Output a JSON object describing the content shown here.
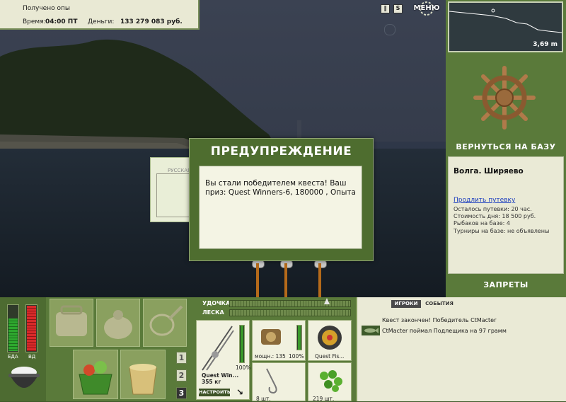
{
  "status": {
    "message": "Получено опы",
    "time_label": "Время:",
    "time_value": "04:00 ПТ",
    "money_label": "Деньги:",
    "money_value": "133 279 083 руб."
  },
  "topbar": {
    "menu_label": "МЕНЮ"
  },
  "depth": {
    "value": "3,69 m"
  },
  "right_panel": {
    "return_label": "ВЕРНУТЬСЯ НА БАЗУ",
    "location": "Волга. Ширяево",
    "extend_link": "Продлить путевку",
    "remaining": "Осталось путевки: 20 час.",
    "cost": "Стоимость дня: 18 500 руб.",
    "fishers": "Рыбаков на базе: 4",
    "tournaments": "Турниры на базе: не объявлены",
    "bans_label": "ЗАПРЕТЫ"
  },
  "dialog": {
    "title": "ПРЕДУПРЕЖДЕНИЕ",
    "message": "Вы стали победителем квеста! Ваш приз: Quest Winners-6, 180000 , Опыта",
    "back_panel_label": "РУССКАЯ"
  },
  "needs": {
    "food_label": "ЕДА",
    "health_label": "ВД"
  },
  "inventory": {
    "pages": [
      "1",
      "2",
      "3"
    ]
  },
  "tackle": {
    "rod_label": "УДОЧКА",
    "line_label": "ЛЕСКА",
    "rod_name": "Quest Win...",
    "rod_weight": "355 кг",
    "rod_percent": "100%",
    "setup_button": "НАСТРОИТЬ",
    "reel_power": "мощн.: 135",
    "reel_percent": "100%",
    "line_name": "Quest Fis...",
    "hook_count": "8 шт.",
    "bait_count": "219 шт."
  },
  "events": {
    "tabs": [
      "ИГРОКИ",
      "СОБЫТИЯ"
    ],
    "items": [
      "Квест закончен! Победитель CtMacter",
      "CtMacter поймал Подлещика на 97 грамм"
    ]
  },
  "colors": {
    "panel_green": "#5a7a3a",
    "dialog_green": "#4e6d2f",
    "cream": "#eaead6",
    "rod_orange": "#b56a1a"
  }
}
